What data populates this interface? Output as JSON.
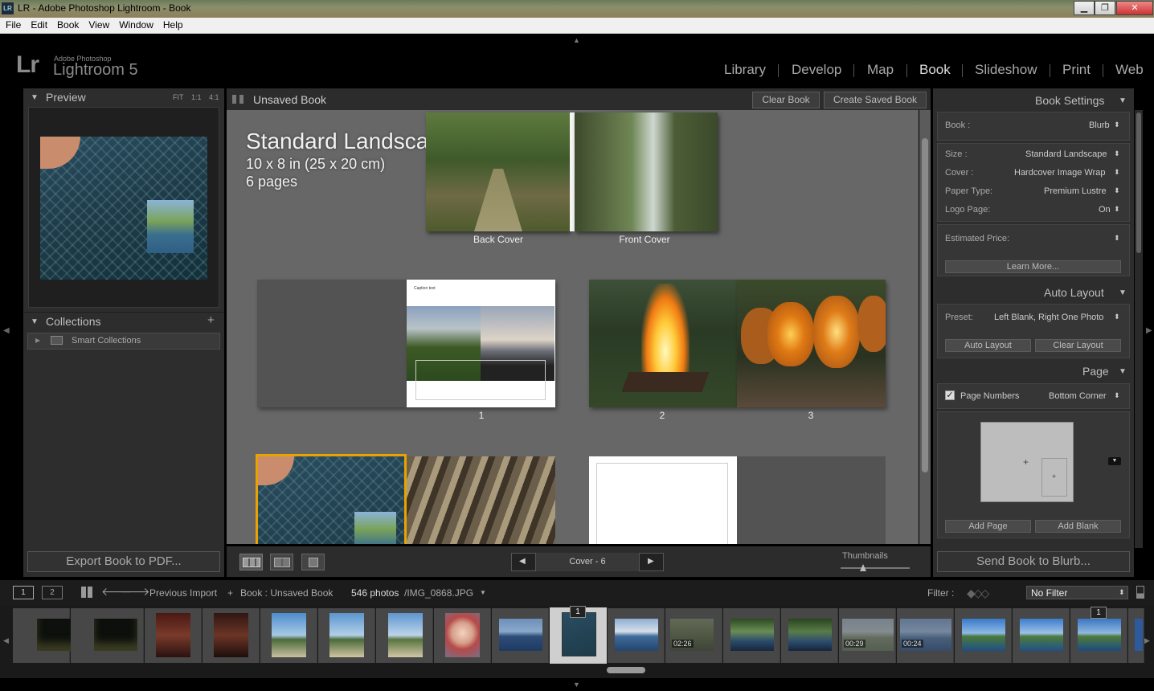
{
  "window": {
    "title": "LR - Adobe Photoshop Lightroom - Book",
    "app_icon": "LR",
    "min": "▁",
    "max": "❐",
    "close": "✕"
  },
  "menu": [
    "File",
    "Edit",
    "Book",
    "View",
    "Window",
    "Help"
  ],
  "brand": {
    "logo": "Lr",
    "company": "Adobe Photoshop",
    "product": "Lightroom 5"
  },
  "modules": [
    "Library",
    "Develop",
    "Map",
    "Book",
    "Slideshow",
    "Print",
    "Web"
  ],
  "active_module": "Book",
  "left": {
    "preview_title": "Preview",
    "zoom": [
      "FIT",
      "1:1",
      "4:1"
    ],
    "collections_title": "Collections",
    "add": "+",
    "smart_collections": "Smart Collections",
    "export_button": "Export Book to PDF..."
  },
  "center": {
    "book_title": "Unsaved Book",
    "clear_book": "Clear Book",
    "create_saved": "Create Saved Book",
    "overlay": {
      "title": "Standard Landscape",
      "size": "10 x 8 in (25 x 20 cm)",
      "pages": "6 pages"
    },
    "labels": {
      "back_cover": "Back Cover",
      "front_cover": "Front Cover",
      "p1": "1",
      "p2": "2",
      "p3": "3"
    },
    "page1_caption": "Caption text",
    "nav": {
      "prev": "◀",
      "page": "Cover - 6",
      "next": "▶"
    },
    "thumbnails_label": "Thumbnails"
  },
  "right": {
    "book_settings": "Book Settings",
    "book_label": "Book :",
    "book_value": "Blurb",
    "size_label": "Size :",
    "size_value": "Standard Landscape",
    "cover_label": "Cover :",
    "cover_value": "Hardcover Image Wrap",
    "paper_label": "Paper Type:",
    "paper_value": "Premium Lustre",
    "logo_label": "Logo Page:",
    "logo_value": "On",
    "price_label": "Estimated Price:",
    "learn_more": "Learn More...",
    "auto_layout": "Auto Layout",
    "preset_label": "Preset:",
    "preset_value": "Left Blank, Right One Photo",
    "auto_layout_btn": "Auto Layout",
    "clear_layout_btn": "Clear Layout",
    "page_title": "Page",
    "page_numbers": "Page Numbers",
    "page_numbers_pos": "Bottom Corner",
    "plus": "+",
    "add_page": "Add Page",
    "add_blank": "Add Blank",
    "send_button": "Send Book to Blurb...",
    "updown": "⬍"
  },
  "filmbar": {
    "view1": "1",
    "view2": "2",
    "source": "Previous Import",
    "plus": "+",
    "book_path": "Book : Unsaved Book",
    "count": "546 photos",
    "file": "/IMG_0868.JPG",
    "filter_label": "Filter :",
    "filter_value": "No Filter"
  },
  "film": {
    "badge_selected": "1",
    "badge_last": "1",
    "d1": "02:26",
    "d2": "00:29",
    "d3": "00:24"
  },
  "colors": {
    "accent": "#e8a300",
    "panel": "#2d2d2d",
    "canvas": "#676767"
  }
}
